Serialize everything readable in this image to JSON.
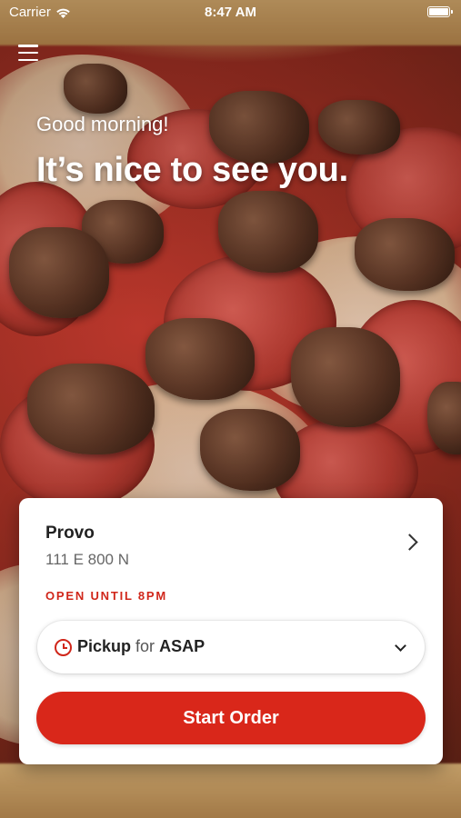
{
  "status_bar": {
    "carrier": "Carrier",
    "time": "8:47 AM",
    "battery_level": 1.0
  },
  "header": {
    "menu_icon": "hamburger-menu-icon",
    "greeting": "Good morning!",
    "headline": "It’s nice to see you."
  },
  "store": {
    "city": "Provo",
    "address": "111 E 800 N",
    "hours": "OPEN UNTIL 8PM"
  },
  "order_type": {
    "icon": "clock-icon",
    "method": "Pickup",
    "connector": "for",
    "time": "ASAP"
  },
  "actions": {
    "start_order_label": "Start Order"
  },
  "colors": {
    "accent": "#d9271a",
    "hours_text": "#d0261a"
  }
}
